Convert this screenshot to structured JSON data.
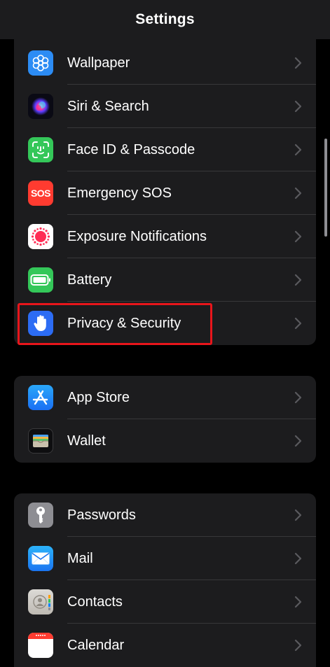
{
  "nav": {
    "title": "Settings"
  },
  "groups": [
    {
      "items": [
        {
          "label": "Wallpaper",
          "icon": "wallpaper-icon",
          "color": "#2c8cf4"
        },
        {
          "label": "Siri & Search",
          "icon": "siri-icon",
          "color": "#1a1a2e"
        },
        {
          "label": "Face ID & Passcode",
          "icon": "face-id-icon",
          "color": "#34c759"
        },
        {
          "label": "Emergency SOS",
          "icon": "sos-icon",
          "color": "#ff3b30",
          "icon_text": "SOS"
        },
        {
          "label": "Exposure Notifications",
          "icon": "exposure-notifications-icon",
          "color": "#ffffff"
        },
        {
          "label": "Battery",
          "icon": "battery-icon",
          "color": "#34c759"
        },
        {
          "label": "Privacy & Security",
          "icon": "hand-raised-icon",
          "color": "#2c6cf4",
          "highlighted": true
        }
      ]
    },
    {
      "items": [
        {
          "label": "App Store",
          "icon": "app-store-icon",
          "color": "#1e8cf5"
        },
        {
          "label": "Wallet",
          "icon": "wallet-icon",
          "color": "#1c1c1e"
        }
      ]
    },
    {
      "items": [
        {
          "label": "Passwords",
          "icon": "key-icon",
          "color": "#8e8e93"
        },
        {
          "label": "Mail",
          "icon": "mail-icon",
          "color": "#1e8cf5"
        },
        {
          "label": "Contacts",
          "icon": "contacts-icon",
          "color": "#c7c7cc"
        },
        {
          "label": "Calendar",
          "icon": "calendar-icon",
          "color": "#ffffff"
        }
      ]
    }
  ],
  "colors": {
    "background": "#000000",
    "cell": "#1c1c1e",
    "separator": "#38383a",
    "highlight": "#e8151b",
    "chevron": "#5a5a5e"
  }
}
